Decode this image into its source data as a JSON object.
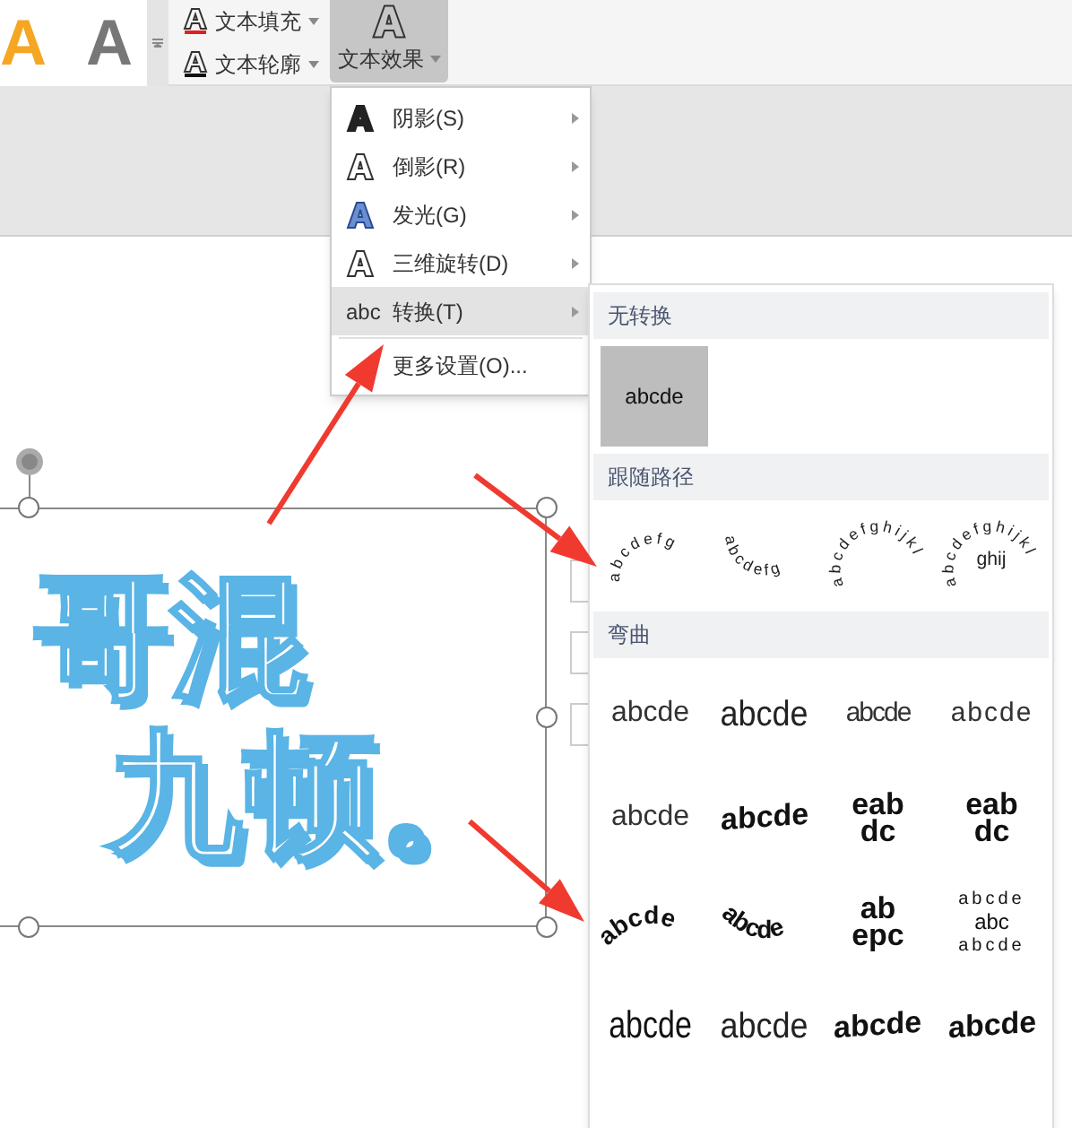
{
  "ribbon": {
    "style_previews": [
      {
        "text": "A",
        "kind": "orange"
      },
      {
        "text": "A",
        "kind": "gradient"
      }
    ],
    "text_buttons": [
      {
        "label": "文本填充",
        "kind": "fill"
      },
      {
        "label": "文本轮廓",
        "kind": "outline"
      }
    ],
    "effect_button": {
      "label": "文本效果",
      "selected": true
    }
  },
  "effect_menu": {
    "items": [
      {
        "label": "阴影(S)",
        "kind": "shadow",
        "submenu": true,
        "selected": false
      },
      {
        "label": "倒影(R)",
        "kind": "reflection",
        "submenu": true,
        "selected": false
      },
      {
        "label": "发光(G)",
        "kind": "glow",
        "submenu": true,
        "selected": false
      },
      {
        "label": "三维旋转(D)",
        "kind": "rotate3d",
        "submenu": true,
        "selected": false
      },
      {
        "label": "转换(T)",
        "kind": "abc",
        "icon_text": "abc",
        "submenu": true,
        "selected": true
      },
      {
        "label": "更多设置(O)...",
        "kind": "none",
        "submenu": false,
        "selected": false
      }
    ]
  },
  "transform_panel": {
    "sections": [
      {
        "title": "无转换",
        "options": [
          {
            "kind": "none",
            "texts": [
              "abcde"
            ],
            "selected": true
          }
        ]
      },
      {
        "title": "跟随路径",
        "options": [
          {
            "kind": "path_arch",
            "texts": [
              "abcdefg"
            ],
            "selected": false
          },
          {
            "kind": "path_smile",
            "texts": [
              "abcdefg"
            ],
            "selected": false
          },
          {
            "kind": "path_circle",
            "texts": [
              "abcdefghijkl"
            ],
            "selected": false
          },
          {
            "kind": "path_button",
            "texts": [
              "abcdefghijkl",
              "ghij"
            ],
            "selected": false
          }
        ]
      },
      {
        "title": "弯曲",
        "options": [
          {
            "kind": "plain",
            "texts": [
              "abcde"
            ],
            "selected": false
          },
          {
            "kind": "tall",
            "texts": [
              "abcde"
            ],
            "selected": false
          },
          {
            "kind": "squeeze",
            "texts": [
              "abcde"
            ],
            "selected": false
          },
          {
            "kind": "wave",
            "texts": [
              "abcde"
            ],
            "selected": false
          },
          {
            "kind": "plain",
            "texts": [
              "abcde"
            ],
            "selected": false
          },
          {
            "kind": "bold_wave",
            "texts": [
              "abcde"
            ],
            "selected": false
          },
          {
            "kind": "stack",
            "texts": [
              "eab",
              "dc"
            ],
            "selected": false
          },
          {
            "kind": "stack",
            "texts": [
              "eab",
              "dc"
            ],
            "selected": false
          },
          {
            "kind": "arch_up",
            "texts": [
              "abcde"
            ],
            "selected": false
          },
          {
            "kind": "arch_down",
            "texts": [
              "abcde"
            ],
            "selected": false
          },
          {
            "kind": "stack",
            "texts": [
              "ab",
              "epc"
            ],
            "selected": false
          },
          {
            "kind": "ring",
            "texts": [
              "abcde",
              "abc",
              "abcde"
            ],
            "selected": false
          },
          {
            "kind": "inflate",
            "texts": [
              "abcde"
            ],
            "selected": false
          },
          {
            "kind": "tall",
            "texts": [
              "abcde"
            ],
            "selected": false
          },
          {
            "kind": "bold_wave",
            "texts": [
              "abcde"
            ],
            "selected": false
          },
          {
            "kind": "bold_wave",
            "texts": [
              "abcde"
            ],
            "selected": false
          }
        ]
      }
    ]
  },
  "canvas": {
    "text_lines": [
      "哥混",
      "九顿。"
    ]
  }
}
